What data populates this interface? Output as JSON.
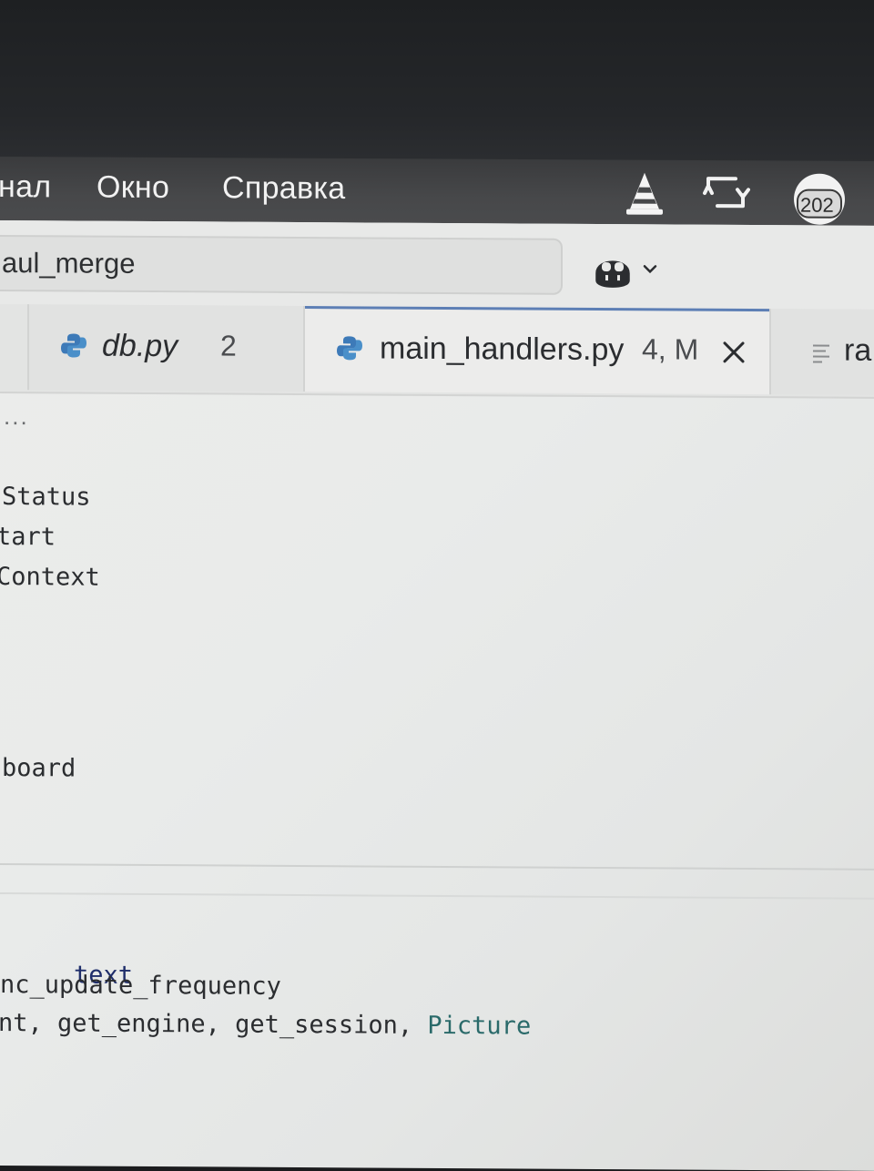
{
  "menubar": {
    "items": [
      {
        "label": "нал"
      },
      {
        "label": "Окно"
      },
      {
        "label": "Справка"
      }
    ],
    "tray": {
      "vlc_icon": "vlc-cone-icon",
      "sync_icon": "sync-arrows-icon",
      "badge_value": "202"
    }
  },
  "branchbar": {
    "branch_label": "aul_merge",
    "copilot_icon": "copilot-icon"
  },
  "tabs": [
    {
      "label": "db.py",
      "badge": "2",
      "icon": "python-icon"
    },
    {
      "label": "main_handlers.py",
      "badge": "4, M",
      "icon": "python-icon",
      "active": true
    },
    {
      "label": "ra",
      "icon": "text-file-icon"
    }
  ],
  "editor": {
    "breadcrumb": "...",
    "lines_top": [
      "Status",
      "tart",
      "Context"
    ],
    "line_board": "board",
    "lines_bottom": [
      {
        "text": "text"
      },
      {
        "text": "nc_update_frequency"
      },
      {
        "prefix": "nt, get_engine, get_session, ",
        "cls": "Picture"
      }
    ]
  },
  "colors": {
    "menubar_bg": "#47484a",
    "active_tab_accent": "#5d7fb5",
    "editor_bg": "#ececeb"
  }
}
